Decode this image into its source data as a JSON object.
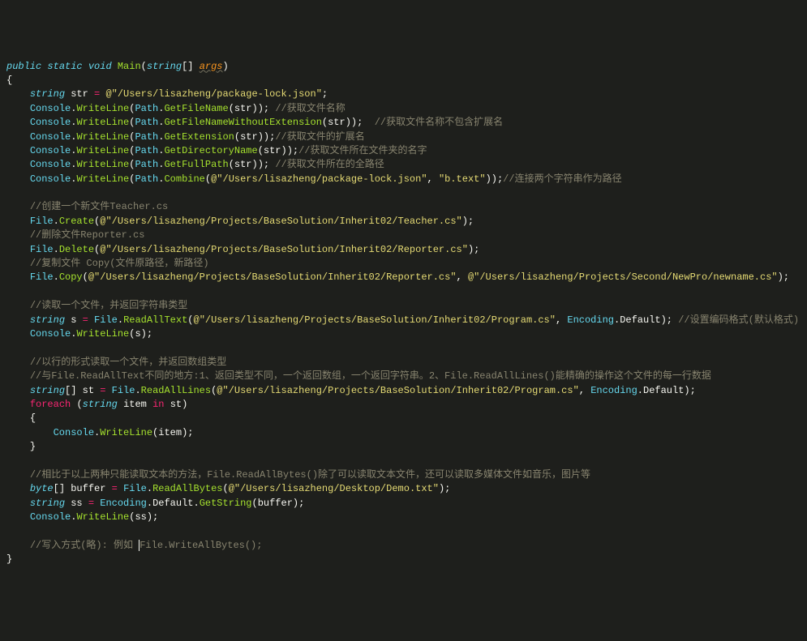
{
  "code": {
    "l1": {
      "kw1": "public",
      "kw2": "static",
      "kw3": "void",
      "method": "Main",
      "type": "string",
      "param": "args"
    },
    "l2": {
      "brace": "{"
    },
    "l3": {
      "type": "string",
      "var": "str",
      "op": "=",
      "str": "\"/Users/lisazheng/package-lock.json\""
    },
    "l4": {
      "cls": "Console",
      "m": "WriteLine",
      "cls2": "Path",
      "m2": "GetFileName",
      "arg": "str",
      "comment": "//获取文件名称"
    },
    "l5": {
      "cls": "Console",
      "m": "WriteLine",
      "cls2": "Path",
      "m2": "GetFileNameWithoutExtension",
      "arg": "str",
      "comment": "//获取文件名称不包含扩展名"
    },
    "l6": {
      "cls": "Console",
      "m": "WriteLine",
      "cls2": "Path",
      "m2": "GetExtension",
      "arg": "str",
      "comment": "//获取文件的扩展名"
    },
    "l7": {
      "cls": "Console",
      "m": "WriteLine",
      "cls2": "Path",
      "m2": "GetDirectoryName",
      "arg": "str",
      "comment": "//获取文件所在文件夹的名字"
    },
    "l8": {
      "cls": "Console",
      "m": "WriteLine",
      "cls2": "Path",
      "m2": "GetFullPath",
      "arg": "str",
      "comment": "//获取文件所在的全路径"
    },
    "l9": {
      "cls": "Console",
      "m": "WriteLine",
      "cls2": "Path",
      "m2": "Combine",
      "str1": "\"/Users/lisazheng/package-lock.json\"",
      "str2": "\"b.text\"",
      "comment": "//连接两个字符串作为路径"
    },
    "l11": {
      "comment": "//创建一个新文件Teacher.cs"
    },
    "l12": {
      "cls": "File",
      "m": "Create",
      "str": "\"/Users/lisazheng/Projects/BaseSolution/Inherit02/Teacher.cs\""
    },
    "l13": {
      "comment": "//删除文件Reporter.cs"
    },
    "l14": {
      "cls": "File",
      "m": "Delete",
      "str": "\"/Users/lisazheng/Projects/BaseSolution/Inherit02/Reporter.cs\""
    },
    "l15": {
      "comment": "//复制文件 Copy(文件原路径，新路径)"
    },
    "l16": {
      "cls": "File",
      "m": "Copy",
      "str1": "\"/Users/lisazheng/Projects/BaseSolution/Inherit02/Reporter.cs\"",
      "str2": "\"/Users/lisazheng/Projects/Second/NewPro/newname.cs\""
    },
    "l18": {
      "comment": "//读取一个文件，并返回字符串类型"
    },
    "l19": {
      "type": "string",
      "var": "s",
      "cls": "File",
      "m": "ReadAllText",
      "str": "\"/Users/lisazheng/Projects/BaseSolution/Inherit02/Program.cs\"",
      "cls2": "Encoding",
      "prop": "Default",
      "comment": "//设置编码格式(默认格式)"
    },
    "l20": {
      "cls": "Console",
      "m": "WriteLine",
      "arg": "s"
    },
    "l22": {
      "comment": "//以行的形式读取一个文件，并返回数组类型"
    },
    "l23": {
      "comment": "//与File.ReadAllText不同的地方:1、返回类型不同，一个返回数组，一个返回字符串。2、File.ReadAllLines()能精确的操作这个文件的每一行数据"
    },
    "l24": {
      "type": "string",
      "var": "st",
      "cls": "File",
      "m": "ReadAllLines",
      "str": "\"/Users/lisazheng/Projects/BaseSolution/Inherit02/Program.cs\"",
      "cls2": "Encoding",
      "prop": "Default"
    },
    "l25": {
      "kw": "foreach",
      "type": "string",
      "var": "item",
      "kw2": "in",
      "arr": "st"
    },
    "l26": {
      "brace": "{"
    },
    "l27": {
      "cls": "Console",
      "m": "WriteLine",
      "arg": "item"
    },
    "l28": {
      "brace": "}"
    },
    "l30": {
      "comment": "//相比于以上两种只能读取文本的方法，File.ReadAllBytes()除了可以读取文本文件，还可以读取多媒体文件如音乐，图片等"
    },
    "l31": {
      "type": "byte",
      "var": "buffer",
      "cls": "File",
      "m": "ReadAllBytes",
      "str": "\"/Users/lisazheng/Desktop/Demo.txt\""
    },
    "l32": {
      "type": "string",
      "var": "ss",
      "cls": "Encoding",
      "prop": "Default",
      "m": "GetString",
      "arg": "buffer"
    },
    "l33": {
      "cls": "Console",
      "m": "WriteLine",
      "arg": "ss"
    },
    "l35": {
      "comment1": "//写入方式(略): 例如 ",
      "comment2": "File.WriteAllBytes();"
    },
    "l36": {
      "brace": "}"
    }
  }
}
